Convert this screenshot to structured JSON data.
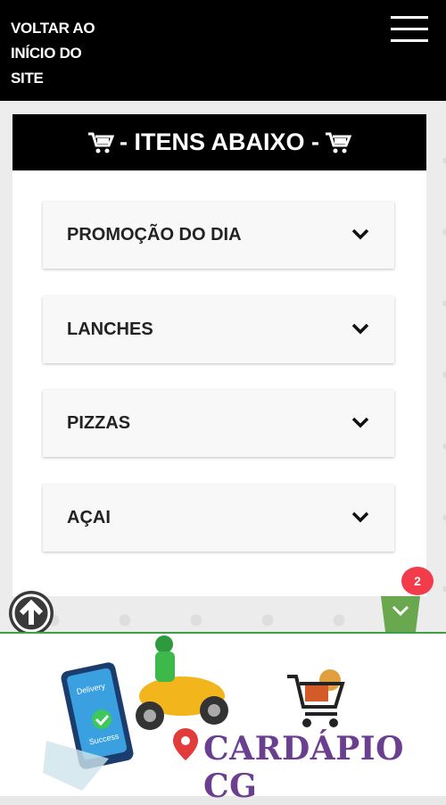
{
  "header": {
    "back_link": "VOLTAR AO INÍCIO DO SITE"
  },
  "panel": {
    "title": "- ITENS ABAIXO -"
  },
  "categories": [
    {
      "label": "PROMOÇÃO DO DIA"
    },
    {
      "label": "LANCHES"
    },
    {
      "label": "PIZZAS"
    },
    {
      "label": "AÇAI"
    }
  ],
  "cart": {
    "count": "2"
  },
  "footer": {
    "brand": "CARDÁPIO CG",
    "phone_text_1": "Delivery",
    "phone_text_2": "Success"
  },
  "colors": {
    "header_bg": "#000000",
    "badge": "#f23c4c",
    "basket": "#6aa84f",
    "brand": "#6b3f8f"
  },
  "icons": [
    "hamburger-menu-icon",
    "cart-icon",
    "chevron-down-icon",
    "arrow-up-icon",
    "shopping-basket-icon"
  ]
}
